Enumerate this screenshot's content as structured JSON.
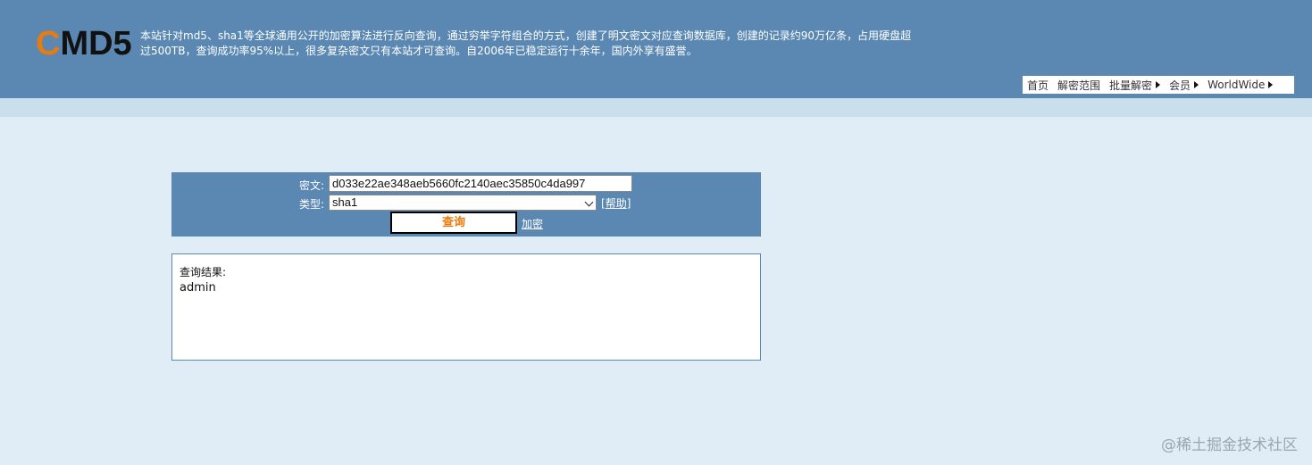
{
  "logo": {
    "letter_c": "C",
    "rest": "MD5"
  },
  "intro_text": "本站针对md5、sha1等全球通用公开的加密算法进行反向查询，通过穷举字符组合的方式，创建了明文密文对应查询数据库，创建的记录约90万亿条，占用硬盘超过500TB，查询成功率95%以上，很多复杂密文只有本站才可查询。自2006年已稳定运行十余年，国内外享有盛誉。",
  "nav": {
    "items": [
      {
        "label": "首页",
        "has_arrow": false
      },
      {
        "label": "解密范围",
        "has_arrow": false
      },
      {
        "label": "批量解密",
        "has_arrow": true
      },
      {
        "label": "会员",
        "has_arrow": true
      },
      {
        "label": "WorldWide",
        "has_arrow": true
      }
    ]
  },
  "form": {
    "cipher_label": "密文:",
    "cipher_value": "d033e22ae348aeb5660fc2140aec35850c4da997",
    "type_label": "类型:",
    "type_value": "sha1",
    "help_label": "帮助",
    "query_button": "查询",
    "encrypt_link": "加密"
  },
  "result": {
    "label": "查询结果:",
    "value": "admin"
  },
  "watermark": "@稀土掘金技术社区",
  "colors": {
    "header_bg": "#5b88b2",
    "accent_orange": "#e87b10",
    "page_bg": "#e1edf6"
  }
}
